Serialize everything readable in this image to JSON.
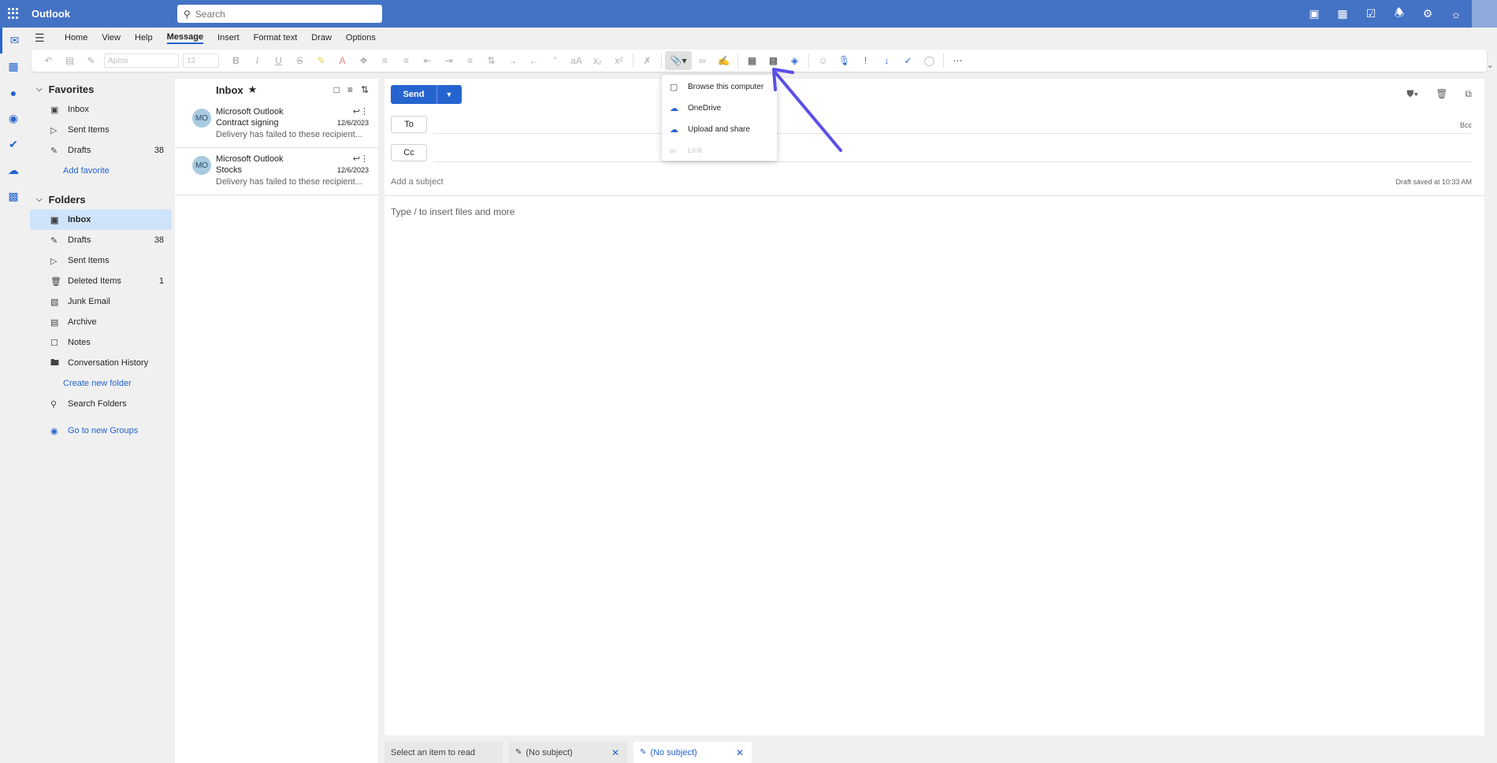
{
  "app": {
    "title": "Outlook"
  },
  "search": {
    "placeholder": "Search"
  },
  "top_icons": [
    "teams-icon",
    "word-icon",
    "calendar-check-icon",
    "bell-icon",
    "gear-icon",
    "lightbulb-icon"
  ],
  "rail": [
    "mail-icon",
    "calendar-icon",
    "people-icon",
    "groups-icon",
    "todo-icon",
    "onedrive-icon",
    "apps-icon"
  ],
  "ribbon": {
    "tabs": [
      "Home",
      "View",
      "Help",
      "Message",
      "Insert",
      "Format text",
      "Draw",
      "Options"
    ],
    "selected_tab": "Message",
    "font_name": "Aptos",
    "font_size": "12"
  },
  "folders": {
    "favorites_header": "Favorites",
    "favorites": [
      {
        "label": "Inbox",
        "icon": "inbox-icon",
        "count": ""
      },
      {
        "label": "Sent Items",
        "icon": "send-icon",
        "count": ""
      },
      {
        "label": "Drafts",
        "icon": "pencil-icon",
        "count": "38"
      }
    ],
    "add_favorite": "Add favorite",
    "folders_header": "Folders",
    "items": [
      {
        "label": "Inbox",
        "icon": "inbox-icon",
        "count": ""
      },
      {
        "label": "Drafts",
        "icon": "pencil-icon",
        "count": "38"
      },
      {
        "label": "Sent Items",
        "icon": "send-icon",
        "count": ""
      },
      {
        "label": "Deleted Items",
        "icon": "trash-icon",
        "count": "1"
      },
      {
        "label": "Junk Email",
        "icon": "junk-icon",
        "count": ""
      },
      {
        "label": "Archive",
        "icon": "archive-icon",
        "count": ""
      },
      {
        "label": "Notes",
        "icon": "note-icon",
        "count": ""
      },
      {
        "label": "Conversation History",
        "icon": "folder-icon",
        "count": ""
      }
    ],
    "create_folder": "Create new folder",
    "search_folders": "Search Folders",
    "groups_link": "Go to new Groups"
  },
  "message_list": {
    "title": "Inbox",
    "messages": [
      {
        "initials": "MO",
        "from": "Microsoft Outlook",
        "subject": "Contract signing",
        "date": "12/6/2023",
        "preview": "Delivery has failed to these recipient..."
      },
      {
        "initials": "MO",
        "from": "Microsoft Outlook",
        "subject": "Stocks",
        "date": "12/6/2023",
        "preview": "Delivery has failed to these recipient..."
      }
    ]
  },
  "compose": {
    "send_label": "Send",
    "to_label": "To",
    "cc_label": "Cc",
    "bcc_label": "Bcc",
    "subject_placeholder": "Add a subject",
    "draft_status": "Draft saved at 10:33 AM",
    "body_placeholder": "Type / to insert files and more"
  },
  "attach_menu": {
    "items": [
      {
        "label": "Browse this computer",
        "icon": "laptop-icon",
        "enabled": true
      },
      {
        "label": "OneDrive",
        "icon": "onedrive-icon",
        "enabled": true
      },
      {
        "label": "Upload and share",
        "icon": "cloud-upload-icon",
        "enabled": true
      },
      {
        "label": "Link",
        "icon": "link-icon",
        "enabled": false
      }
    ]
  },
  "bottom_tabs": {
    "read": "Select an item to read",
    "draft1": "(No subject)",
    "draft2": "(No subject)"
  },
  "colors": {
    "brand": "#4472c4",
    "accent": "#2564cf",
    "annotation_arrow": "#5b50e6"
  }
}
